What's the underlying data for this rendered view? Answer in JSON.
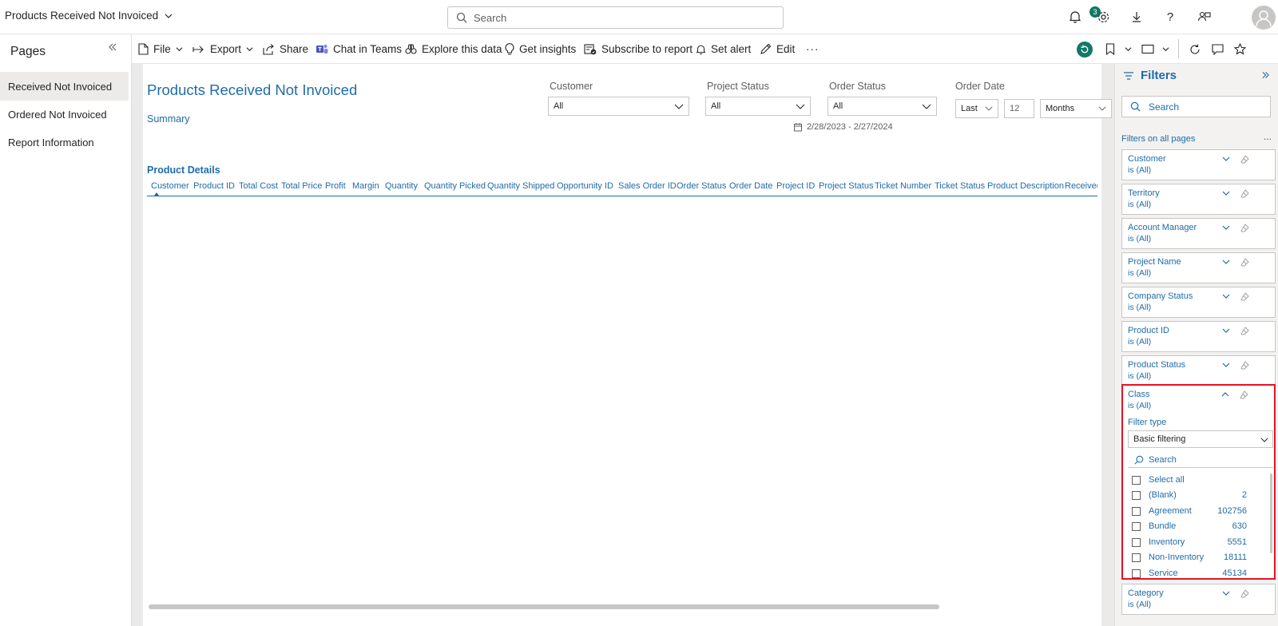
{
  "app": {
    "title": "Products Received Not Invoiced",
    "search_placeholder": "Search",
    "notification_count": "3"
  },
  "pages_pane": {
    "title": "Pages",
    "items": [
      {
        "label": "Received Not Invoiced",
        "active": true
      },
      {
        "label": "Ordered Not Invoiced",
        "active": false
      },
      {
        "label": "Report Information",
        "active": false
      }
    ]
  },
  "actionbar": {
    "file": "File",
    "export": "Export",
    "share": "Share",
    "chat": "Chat in Teams",
    "explore": "Explore this data",
    "insights": "Get insights",
    "subscribe": "Subscribe to report",
    "alert": "Set alert",
    "edit": "Edit",
    "more": "···"
  },
  "report": {
    "title": "Products Received Not Invoiced",
    "summary_link": "Summary",
    "slicers": {
      "customer": {
        "label": "Customer",
        "value": "All"
      },
      "project_status": {
        "label": "Project Status",
        "value": "All"
      },
      "order_status": {
        "label": "Order Status",
        "value": "All"
      },
      "order_date": {
        "label": "Order Date",
        "relative": "Last",
        "count": "12",
        "unit": "Months",
        "range": "2/28/2023 - 2/27/2024"
      }
    },
    "table": {
      "title": "Product Details",
      "columns": [
        "Customer",
        "Product ID",
        "Total Cost",
        "Total Price",
        "Profit",
        "Margin",
        "Quantity",
        "Quantity Picked",
        "Quantity Shipped",
        "Opportunity ID",
        "Sales Order ID",
        "Order Status",
        "Order Date",
        "Project ID",
        "Project Status",
        "Ticket Number",
        "Ticket Status",
        "Product Description",
        "Received"
      ]
    }
  },
  "filters": {
    "title": "Filters",
    "search_placeholder": "Search",
    "section_label": "Filters on all pages",
    "section_more": "...",
    "cards": [
      {
        "name": "Customer",
        "value": "is (All)"
      },
      {
        "name": "Territory",
        "value": "is (All)"
      },
      {
        "name": "Account Manager",
        "value": "is (All)"
      },
      {
        "name": "Project Name",
        "value": "is (All)"
      },
      {
        "name": "Company Status",
        "value": "is (All)"
      },
      {
        "name": "Product ID",
        "value": "is (All)"
      },
      {
        "name": "Product Status",
        "value": "is (All)"
      }
    ],
    "class_card": {
      "name": "Class",
      "value": "is (All)",
      "filter_type_label": "Filter type",
      "filter_type_value": "Basic filtering",
      "search_placeholder": "Search",
      "options": [
        {
          "label": "Select all",
          "count": ""
        },
        {
          "label": "(Blank)",
          "count": "2"
        },
        {
          "label": "Agreement",
          "count": "102756"
        },
        {
          "label": "Bundle",
          "count": "630"
        },
        {
          "label": "Inventory",
          "count": "5551"
        },
        {
          "label": "Non-Inventory",
          "count": "18111"
        },
        {
          "label": "Service",
          "count": "45134"
        }
      ]
    },
    "category_card": {
      "name": "Category",
      "value": "is (All)"
    }
  },
  "colors": {
    "accent": "#1f6ca8",
    "highlight": "#e81123",
    "badge": "#117865"
  }
}
